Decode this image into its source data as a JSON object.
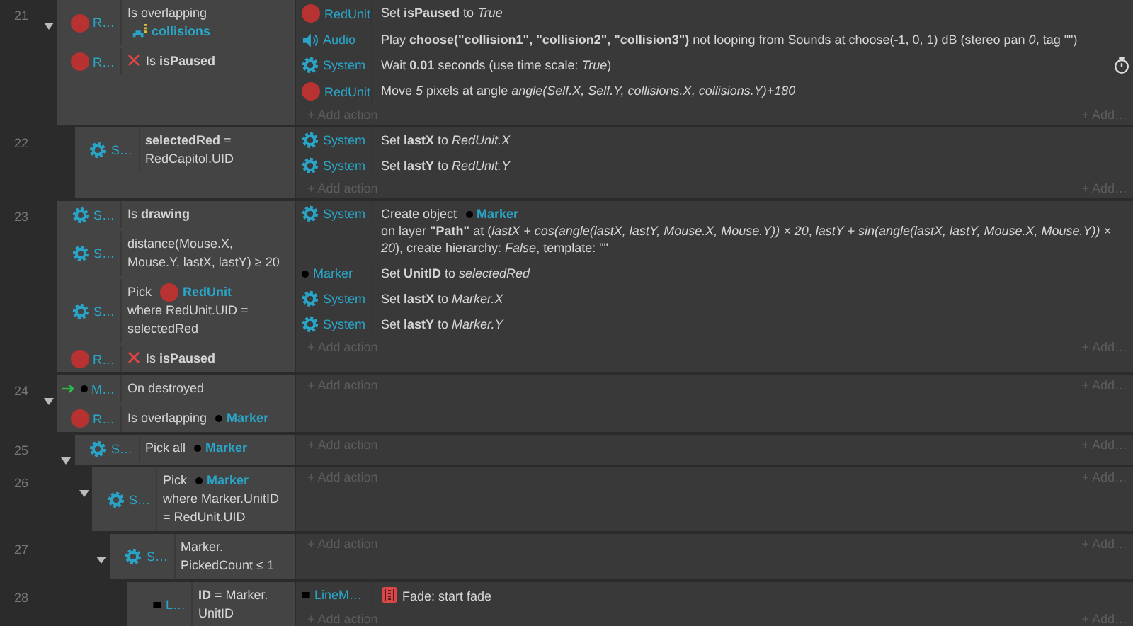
{
  "events": [
    {
      "number": "21",
      "expanded": true,
      "conditions": [
        {
          "object": {
            "kind": "sprite",
            "name": "R…"
          },
          "inverted": false,
          "parts": [
            {
              "kind": "text",
              "text": "Is overlapping"
            },
            {
              "kind": "object",
              "object": {
                "kind": "tilemap",
                "name": "collisions"
              }
            }
          ]
        },
        {
          "object": {
            "kind": "sprite",
            "name": "R…"
          },
          "inverted": true,
          "parts": [
            {
              "kind": "text",
              "text": "Is **isPaused**"
            }
          ]
        }
      ],
      "actions": [
        {
          "object": {
            "kind": "sprite",
            "name": "RedUnit"
          },
          "kind": "plain",
          "parts": [
            {
              "kind": "text",
              "text": "Set **isPaused** to *True*"
            }
          ]
        },
        {
          "object": {
            "kind": "audio",
            "name": "Audio"
          },
          "kind": "plain",
          "parts": [
            {
              "kind": "text",
              "text": "Play **choose(\"collision1\", \"collision2\", \"collision3\")** not looping from Sounds at choose(-1, 0, 1) dB (stereo pan *0*, tag \"\")"
            }
          ]
        },
        {
          "object": {
            "kind": "system",
            "name": "System"
          },
          "kind": "wait",
          "parts": [
            {
              "kind": "text",
              "text": "Wait **0.01** seconds (use time scale: *True*)"
            }
          ]
        },
        {
          "object": {
            "kind": "sprite",
            "name": "RedUnit"
          },
          "kind": "plain",
          "parts": [
            {
              "kind": "text",
              "text": "Move *5* pixels at angle *angle(Self.X, Self.Y, collisions.X, collisions.Y)+180*"
            }
          ]
        }
      ],
      "add_action": "+ Add action",
      "add_more": "+ Add…",
      "children": [
        {
          "number": "22",
          "conditions": [
            {
              "object": {
                "kind": "system",
                "name": "S…"
              },
              "inverted": false,
              "parts": [
                {
                  "kind": "text",
                  "text": "**selectedRed** = RedCapitol.UID"
                }
              ]
            }
          ],
          "actions": [
            {
              "object": {
                "kind": "system",
                "name": "System"
              },
              "kind": "plain",
              "parts": [
                {
                  "kind": "text",
                  "text": "Set **lastX** to *RedUnit.X*"
                }
              ]
            },
            {
              "object": {
                "kind": "system",
                "name": "System"
              },
              "kind": "plain",
              "parts": [
                {
                  "kind": "text",
                  "text": "Set **lastY** to *RedUnit.Y*"
                }
              ]
            }
          ],
          "add_action": "+ Add action",
          "add_more": "+ Add…"
        }
      ]
    },
    {
      "number": "23",
      "conditions": [
        {
          "object": {
            "kind": "system",
            "name": "S…"
          },
          "inverted": false,
          "parts": [
            {
              "kind": "text",
              "text": "Is **drawing**"
            }
          ]
        },
        {
          "object": {
            "kind": "system",
            "name": "S…"
          },
          "inverted": false,
          "parts": [
            {
              "kind": "text",
              "text": "distance(Mouse.X, Mouse.Y, lastX, lastY) ≥ 20"
            }
          ]
        },
        {
          "object": {
            "kind": "system",
            "name": "S…"
          },
          "inverted": false,
          "parts": [
            {
              "kind": "text",
              "text": "Pick"
            },
            {
              "kind": "object",
              "object": {
                "kind": "sprite",
                "name": "RedUnit"
              }
            },
            {
              "kind": "text",
              "text": "where RedUnit.UID = selectedRed"
            }
          ]
        },
        {
          "object": {
            "kind": "sprite",
            "name": "R…"
          },
          "inverted": true,
          "parts": [
            {
              "kind": "text",
              "text": "Is **isPaused**"
            }
          ]
        }
      ],
      "actions": [
        {
          "object": {
            "kind": "system",
            "name": "System"
          },
          "kind": "plain",
          "parts": [
            {
              "kind": "text",
              "text": "Create object"
            },
            {
              "kind": "object",
              "object": {
                "kind": "dot",
                "name": "Marker"
              }
            },
            {
              "kind": "text",
              "text": "on layer **\"Path\"** at (*lastX + cos(angle(lastX, lastY, Mouse.X, Mouse.Y)) × 20*, *lastY + sin(angle(lastX, lastY, Mouse.X, Mouse.Y)) × 20*), create hierarchy: *False*, template: \"\""
            }
          ]
        },
        {
          "object": {
            "kind": "dot",
            "name": "Marker"
          },
          "kind": "plain",
          "parts": [
            {
              "kind": "text",
              "text": "Set **UnitID** to *selectedRed*"
            }
          ]
        },
        {
          "object": {
            "kind": "system",
            "name": "System"
          },
          "kind": "plain",
          "parts": [
            {
              "kind": "text",
              "text": "Set **lastX** to *Marker.X*"
            }
          ]
        },
        {
          "object": {
            "kind": "system",
            "name": "System"
          },
          "kind": "plain",
          "parts": [
            {
              "kind": "text",
              "text": "Set **lastY** to *Marker.Y*"
            }
          ]
        }
      ],
      "add_action": "+ Add action",
      "add_more": "+ Add…"
    },
    {
      "number": "24",
      "expanded": true,
      "trigger": true,
      "conditions": [
        {
          "object": {
            "kind": "dot",
            "name": "M…"
          },
          "inverted": false,
          "parts": [
            {
              "kind": "text",
              "text": "On destroyed"
            }
          ]
        },
        {
          "object": {
            "kind": "sprite",
            "name": "R…"
          },
          "inverted": false,
          "parts": [
            {
              "kind": "text",
              "text": "Is overlapping"
            },
            {
              "kind": "object",
              "object": {
                "kind": "dot",
                "name": "Marker"
              }
            }
          ]
        }
      ],
      "add_action": "+ Add action",
      "add_more": "+ Add…",
      "children": [
        {
          "number": "25",
          "expanded": true,
          "conditions": [
            {
              "object": {
                "kind": "system",
                "name": "S…"
              },
              "inverted": false,
              "parts": [
                {
                  "kind": "text",
                  "text": "Pick all"
                },
                {
                  "kind": "object",
                  "object": {
                    "kind": "dot",
                    "name": "Marker"
                  }
                }
              ]
            }
          ],
          "add_action": "+ Add action",
          "add_more": "+ Add…",
          "children": [
            {
              "number": "26",
              "expanded": true,
              "conditions": [
                {
                  "object": {
                    "kind": "system",
                    "name": "S…"
                  },
                  "inverted": false,
                  "parts": [
                    {
                      "kind": "text",
                      "text": "Pick"
                    },
                    {
                      "kind": "object",
                      "object": {
                        "kind": "dot",
                        "name": "Marker"
                      }
                    },
                    {
                      "kind": "text",
                      "text": "where Marker.UnitID = RedUnit.UID"
                    }
                  ]
                }
              ],
              "add_action": "+ Add action",
              "add_more": "+ Add…",
              "children": [
                {
                  "number": "27",
                  "expanded": true,
                  "conditions": [
                    {
                      "object": {
                        "kind": "system",
                        "name": "S…"
                      },
                      "inverted": false,
                      "parts": [
                        {
                          "kind": "text",
                          "text": "Marker. PickedCount ≤ 1"
                        }
                      ]
                    }
                  ],
                  "add_action": "+ Add action",
                  "add_more": "+ Add…",
                  "children": [
                    {
                      "number": "28",
                      "conditions": [
                        {
                          "object": {
                            "kind": "square",
                            "name": "L…"
                          },
                          "inverted": false,
                          "parts": [
                            {
                              "kind": "text",
                              "text": "**ID** = Marker. UnitID"
                            }
                          ]
                        }
                      ],
                      "actions": [
                        {
                          "object": {
                            "kind": "square",
                            "name": "LineM…"
                          },
                          "kind": "behavior",
                          "parts": [
                            {
                              "kind": "text",
                              "text": "Fade: start fade"
                            }
                          ]
                        }
                      ],
                      "add_action": "+ Add action",
                      "add_more": "+ Add…"
                    }
                  ]
                }
              ]
            }
          ]
        }
      ]
    }
  ]
}
